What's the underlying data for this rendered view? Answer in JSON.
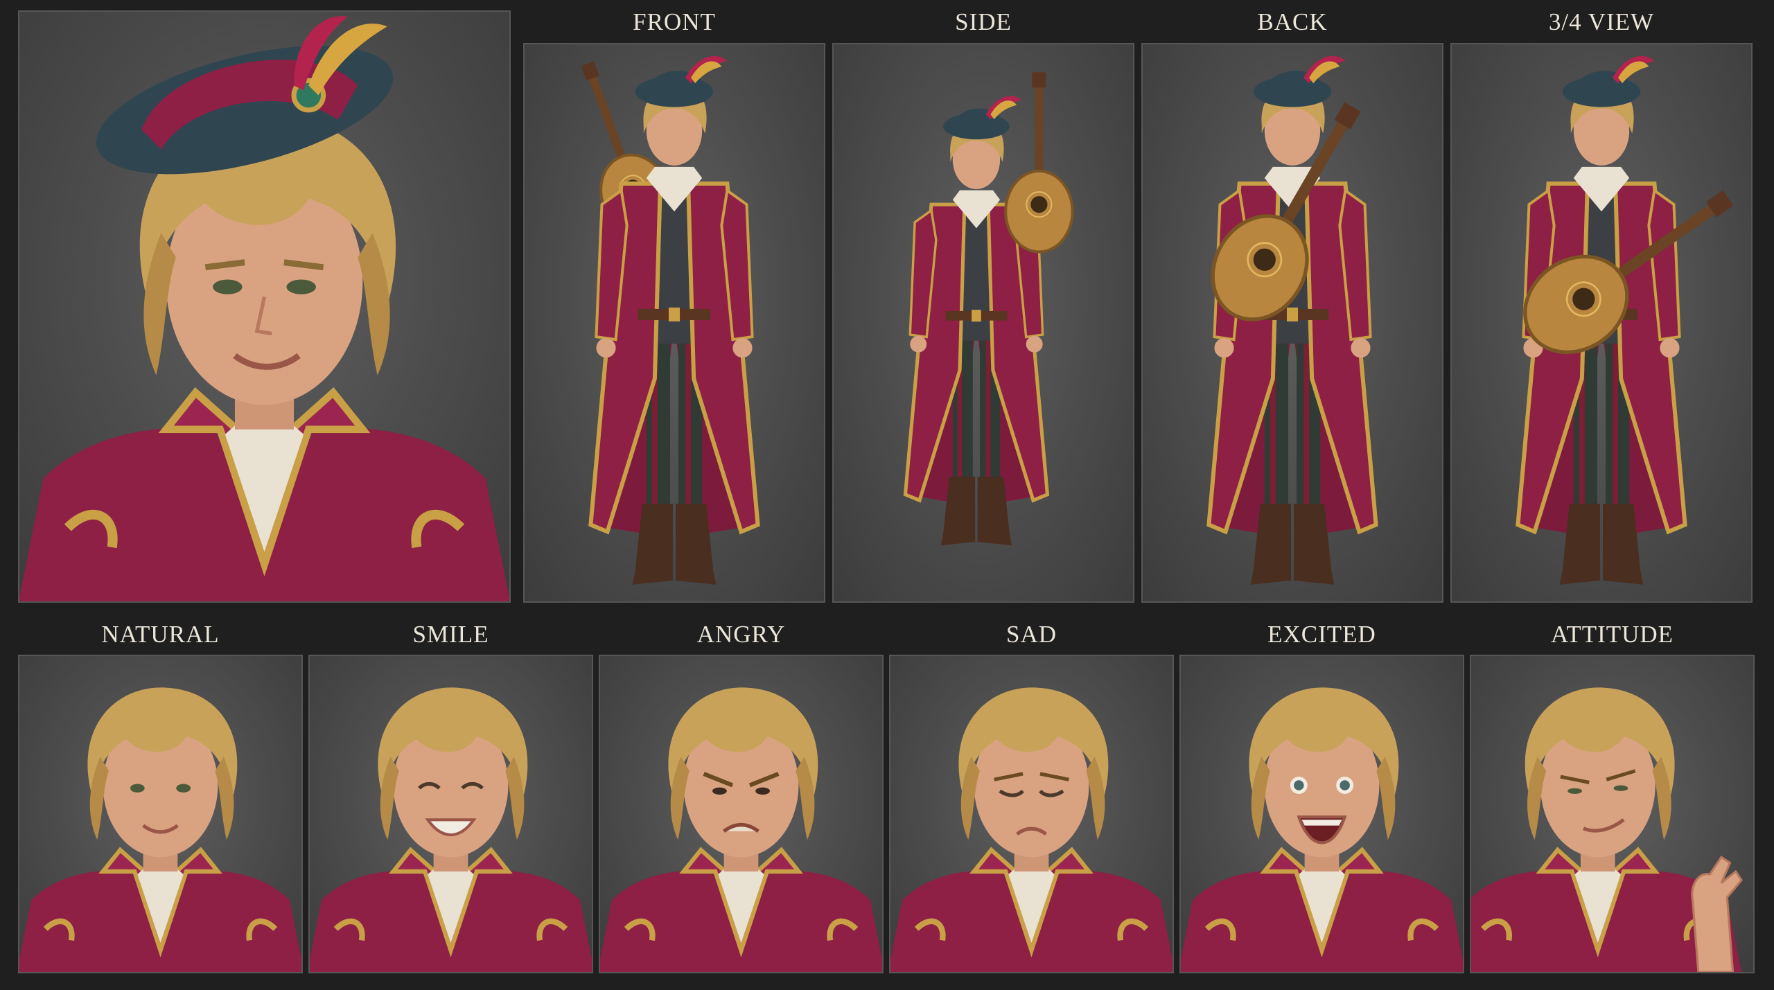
{
  "turnaround": {
    "views": [
      {
        "label": "FRONT"
      },
      {
        "label": "SIDE"
      },
      {
        "label": "BACK"
      },
      {
        "label": "3/4 VIEW"
      }
    ]
  },
  "expressions": {
    "items": [
      {
        "label": "NATURAL"
      },
      {
        "label": "SMILE"
      },
      {
        "label": "ANGRY"
      },
      {
        "label": "SAD"
      },
      {
        "label": "EXCITED"
      },
      {
        "label": "ATTITUDE"
      }
    ]
  },
  "palette": {
    "background": "#1f1f1f",
    "panel": "#4e4e4e",
    "coat_crimson": "#8e1f45",
    "gold_trim": "#c9a045",
    "hair_blond": "#c9a25a",
    "hat_teal": "#2f4650",
    "skin": "#d9a382",
    "boots": "#4a2e1f",
    "lute_wood": "#b8863f"
  }
}
